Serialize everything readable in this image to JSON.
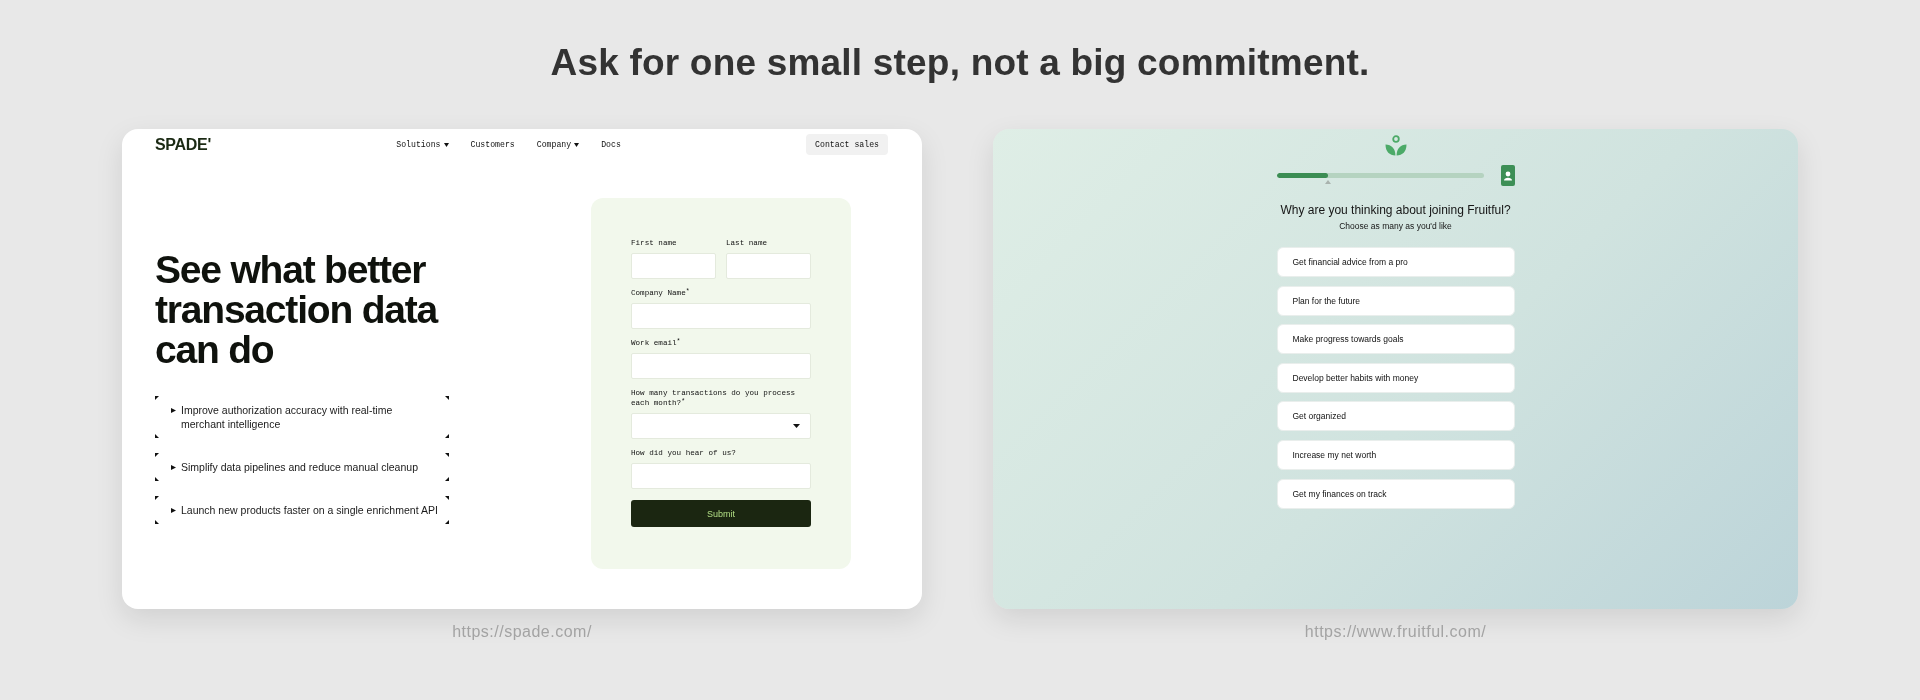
{
  "title": "Ask for one small step, not a big commitment.",
  "spade": {
    "logo": "SPADE'",
    "nav": [
      {
        "label": "Solutions",
        "kind": "dropdown"
      },
      {
        "label": "Customers",
        "kind": "link"
      },
      {
        "label": "Company",
        "kind": "dropdown"
      },
      {
        "label": "Docs",
        "kind": "link"
      }
    ],
    "cta": "Contact sales",
    "headline": "See what better transaction data can do",
    "benefits": [
      "Improve authorization accuracy with real-time merchant intelligence",
      "Simplify data pipelines and reduce manual cleanup",
      "Launch new products faster on a single enrichment API"
    ],
    "form": {
      "rows": [
        {
          "fields": [
            {
              "label": "First name",
              "kind": "text"
            },
            {
              "label": "Last name",
              "kind": "text"
            }
          ]
        },
        {
          "fields": [
            {
              "label": "Company Name$^{*}$",
              "kind": "text"
            }
          ]
        },
        {
          "fields": [
            {
              "label": "Work email$^{*}$",
              "kind": "text"
            }
          ]
        },
        {
          "fields": [
            {
              "label": "How many transactions do you process each month?$^{*}$",
              "kind": "select"
            }
          ]
        },
        {
          "fields": [
            {
              "label": "How did you hear of us?",
              "kind": "text"
            }
          ]
        }
      ],
      "submit": "Submit"
    },
    "url": "https://spade.com/"
  },
  "fruitful": {
    "progress": {
      "level": 0.25
    },
    "question": "Why are you thinking about joining Fruitful?",
    "hint": "Choose as many as you'd like",
    "options": [
      {
        "label": "Get financial advice from a pro",
        "selected": false
      },
      {
        "label": "Plan for the future",
        "selected": false
      },
      {
        "label": "Make progress towards goals",
        "selected": false
      },
      {
        "label": "Develop better habits with money",
        "selected": false
      },
      {
        "label": "Get organized",
        "selected": false
      },
      {
        "label": "Increase my net worth",
        "selected": false
      },
      {
        "label": "Get my finances on track",
        "selected": false
      }
    ],
    "url": "https://www.fruitful.com/"
  }
}
